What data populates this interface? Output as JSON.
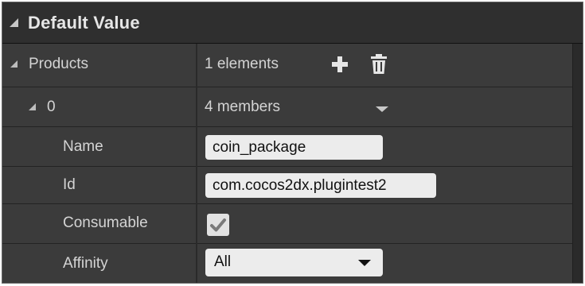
{
  "section": {
    "title": "Default Value"
  },
  "products": {
    "label": "Products",
    "summary": "1 elements",
    "add_icon": "plus-icon",
    "delete_icon": "trash-icon"
  },
  "element": {
    "index": "0",
    "summary": "4 members",
    "fields": {
      "name": {
        "label": "Name",
        "value": "coin_package"
      },
      "id": {
        "label": "Id",
        "value": "com.cocos2dx.plugintest2"
      },
      "consumable": {
        "label": "Consumable",
        "checked": true
      },
      "affinity": {
        "label": "Affinity",
        "value": "All"
      }
    }
  }
}
